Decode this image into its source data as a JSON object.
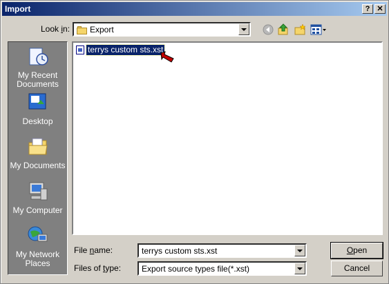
{
  "window": {
    "title": "Import",
    "help_label": "?",
    "close_label": "X"
  },
  "lookin": {
    "label_prefix": "Look ",
    "label_hotkey": "i",
    "label_suffix": "n:",
    "value": "Export"
  },
  "toolbar": {
    "icons": [
      "back-icon",
      "up-folder-icon",
      "new-folder-icon",
      "views-menu-icon"
    ]
  },
  "places": [
    {
      "label": "My Recent Documents",
      "icon": "recent-documents-icon"
    },
    {
      "label": "Desktop",
      "icon": "desktop-icon"
    },
    {
      "label": "My Documents",
      "icon": "my-documents-icon"
    },
    {
      "label": "My Computer",
      "icon": "my-computer-icon"
    },
    {
      "label": "My Network Places",
      "icon": "network-places-icon"
    }
  ],
  "files": [
    {
      "name": "terrys custom sts.xst",
      "selected": true
    }
  ],
  "filename": {
    "label_prefix": "File ",
    "label_hotkey": "n",
    "label_suffix": "ame:",
    "value": "terrys custom sts.xst"
  },
  "filetype": {
    "label_prefix": "Files of ",
    "label_hotkey": "t",
    "label_suffix": "ype:",
    "value": "Export source types file(*.xst)"
  },
  "buttons": {
    "open_hotkey": "O",
    "open_rest": "pen",
    "cancel": "Cancel"
  }
}
